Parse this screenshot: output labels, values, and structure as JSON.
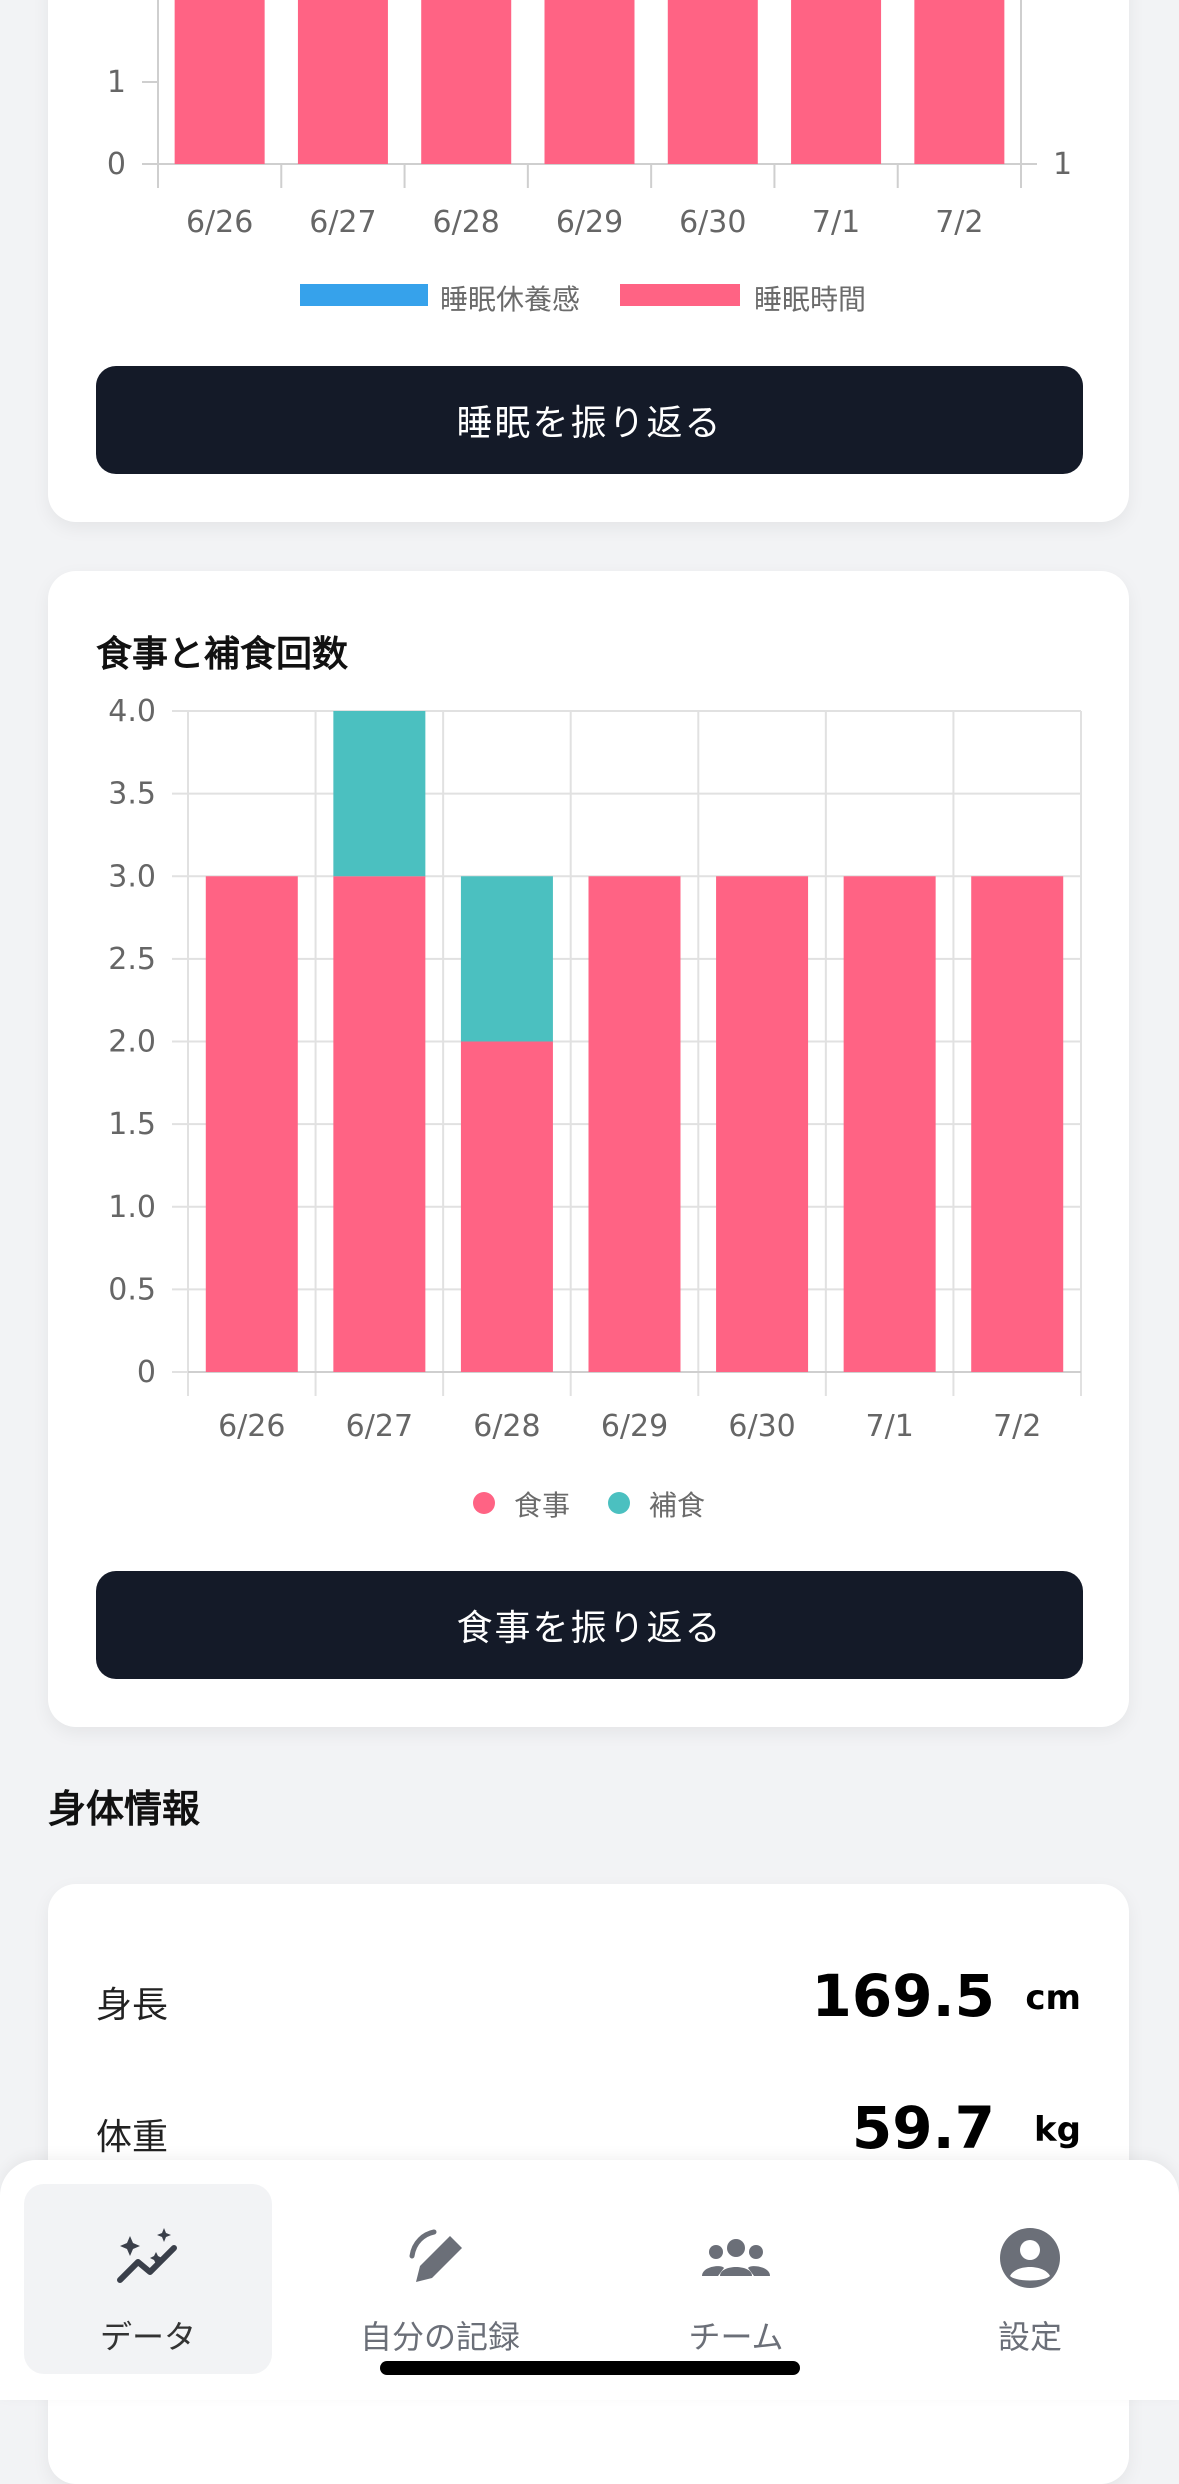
{
  "sleep_chart": {
    "chart_data": {
      "type": "bar",
      "categories": [
        "6/26",
        "6/27",
        "6/28",
        "6/29",
        "6/30",
        "7/1",
        "7/2"
      ],
      "series": [
        {
          "name": "睡眠休養感",
          "values": [
            0,
            0,
            0,
            0,
            0,
            0,
            0
          ],
          "color": "#36a2eb"
        },
        {
          "name": "睡眠時間",
          "values": [
            2,
            2,
            2,
            2,
            2,
            2,
            2
          ],
          "color": "#ff6384"
        }
      ],
      "left_ticks": [
        "0",
        "1"
      ],
      "right_ticks": [
        "1"
      ]
    },
    "legend": [
      "睡眠休養感",
      "睡眠時間"
    ],
    "button_label": "睡眠を振り返る"
  },
  "meal_chart": {
    "title": "食事と補食回数",
    "chart_data": {
      "type": "bar",
      "stacked": true,
      "categories": [
        "6/26",
        "6/27",
        "6/28",
        "6/29",
        "6/30",
        "7/1",
        "7/2"
      ],
      "series": [
        {
          "name": "食事",
          "values": [
            3,
            3,
            2,
            3,
            3,
            3,
            3
          ],
          "color": "#ff6384"
        },
        {
          "name": "補食",
          "values": [
            0,
            1,
            1,
            0,
            0,
            0,
            0
          ],
          "color": "#4bc0c0"
        }
      ],
      "ylim": [
        0,
        4.0
      ],
      "yticks": [
        "0",
        "0.5",
        "1.0",
        "1.5",
        "2.0",
        "2.5",
        "3.0",
        "3.5",
        "4.0"
      ],
      "grid": true,
      "legend_position": "bottom"
    },
    "legend": [
      "食事",
      "補食"
    ],
    "button_label": "食事を振り返る"
  },
  "body_info": {
    "section_title": "身体情報",
    "rows": [
      {
        "label": "身長",
        "value": "169.5",
        "unit": "cm"
      },
      {
        "label": "体重",
        "value": "59.7",
        "unit": "kg"
      }
    ]
  },
  "tabs": [
    {
      "label": "データ",
      "icon": "sparkle-chart-icon",
      "active": true
    },
    {
      "label": "自分の記録",
      "icon": "edit-pencil-icon",
      "active": false
    },
    {
      "label": "チーム",
      "icon": "group-icon",
      "active": false
    },
    {
      "label": "設定",
      "icon": "account-circle-icon",
      "active": false
    }
  ],
  "colors": {
    "accent": "#141a28",
    "meal": "#ff6384",
    "snack": "#4bc0c0",
    "sleep_quality": "#36a2eb"
  }
}
